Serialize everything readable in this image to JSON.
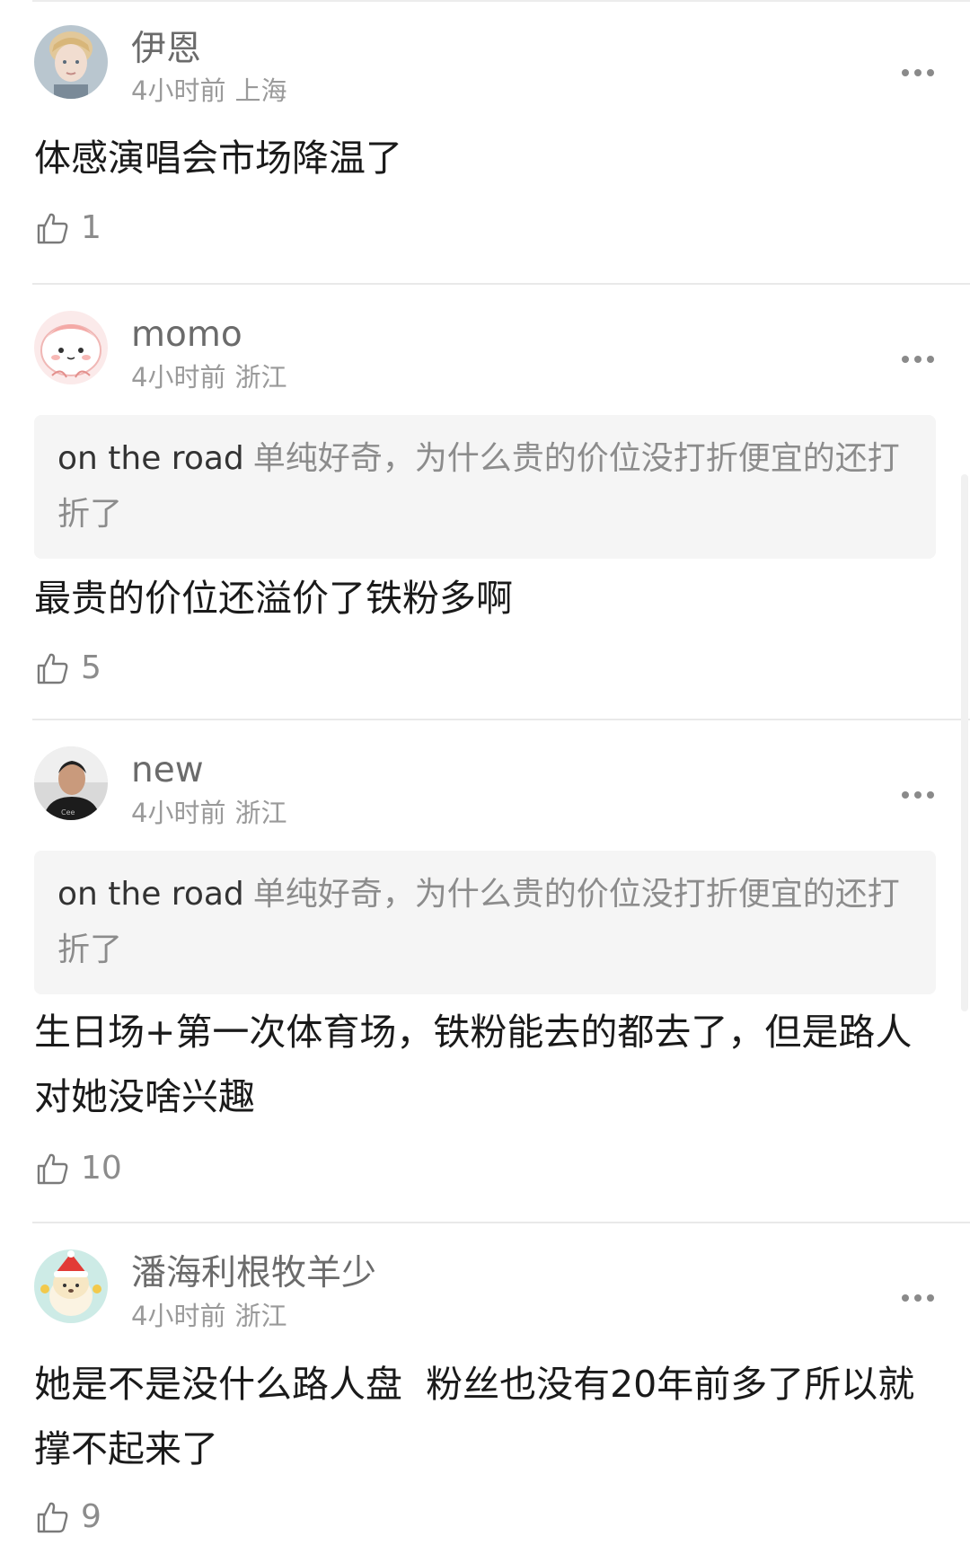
{
  "comments": [
    {
      "username": "伊恩",
      "time": "4小时前",
      "location": "上海",
      "quote": null,
      "text": "体感演唱会市场降温了",
      "likes": "1",
      "avatar": "blond-boy-avatar"
    },
    {
      "username": "momo",
      "time": "4小时前",
      "location": "浙江",
      "quote": {
        "name": "on the road",
        "text": "单纯好奇，为什么贵的价位没打折便宜的还打折了"
      },
      "text": "最贵的价位还溢价了铁粉多啊",
      "likes": "5",
      "avatar": "pink-cartoon-avatar"
    },
    {
      "username": "new",
      "time": "4小时前",
      "location": "浙江",
      "quote": {
        "name": "on the road",
        "text": "单纯好奇，为什么贵的价位没打折便宜的还打折了"
      },
      "text": "生日场+第一次体育场，铁粉能去的都去了，但是路人对她没啥兴趣",
      "likes": "10",
      "avatar": "man-photo-avatar"
    },
    {
      "username": "潘海利根牧羊少",
      "time": "4小时前",
      "location": "浙江",
      "quote": null,
      "text": "她是不是没什么路人盘  粉丝也没有20年前多了所以就撑不起来了",
      "likes": "9",
      "avatar": "cartoon-dog-santa-avatar"
    }
  ],
  "icons": {
    "like": "thumbs-up-outline-icon",
    "more": "more-dots-icon"
  },
  "colors": {
    "username": "#6b6b6b",
    "meta": "#9a9a9a",
    "quote_bg": "#f5f5f5",
    "text": "#1a1a1a"
  }
}
